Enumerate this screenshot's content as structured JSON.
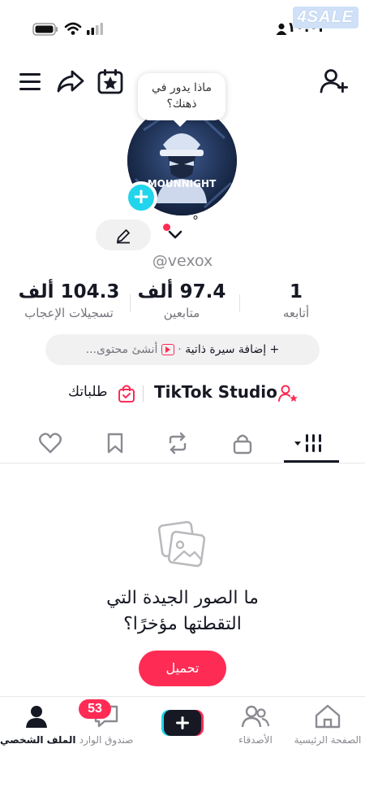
{
  "status_bar": {
    "time": "١٠:٠٢",
    "watermark": "4SALE"
  },
  "header": {
    "menu_icon": "hamburger-icon",
    "share_icon": "share-arrow-icon",
    "calendar_icon": "calendar-star-icon",
    "add_user_icon": "add-user-icon"
  },
  "profile": {
    "note_bubble": "ماذا يدور في ذهنك؟",
    "handle": "@vexox",
    "avatar_text": "MOUNNIGHT",
    "name_mark": "°"
  },
  "stats": [
    {
      "value": "1",
      "label": "أتابعه"
    },
    {
      "value": "97.4 ألف",
      "label": "متابعين"
    },
    {
      "value": "104.3 ألف",
      "label": "تسجيلات الإعجاب"
    }
  ],
  "bio_row": {
    "add_bio": "+ إضافة سيرة ذاتية",
    "separator": "·",
    "create_content": "أنشئ محتوى..."
  },
  "links": {
    "studio": "TikTok Studio",
    "orders": "طلباتك"
  },
  "tabs": [
    "videos-tab",
    "private-tab",
    "reposts-tab",
    "favorites-tab",
    "liked-tab"
  ],
  "empty_state": {
    "line1": "ما الصور الجيدة التي",
    "line2": "التقطتها مؤخرًا؟",
    "upload_button": "تحميل"
  },
  "bottom_nav": {
    "home": "الصفحة الرئيسية",
    "friends": "الأصدقاء",
    "inbox": "صندوق الوارد",
    "inbox_badge": "53",
    "profile": "الملف الشخصي"
  },
  "colors": {
    "accent": "#fe2c55",
    "cyan": "#20d5ec",
    "text": "#161823",
    "muted": "#73757c"
  }
}
